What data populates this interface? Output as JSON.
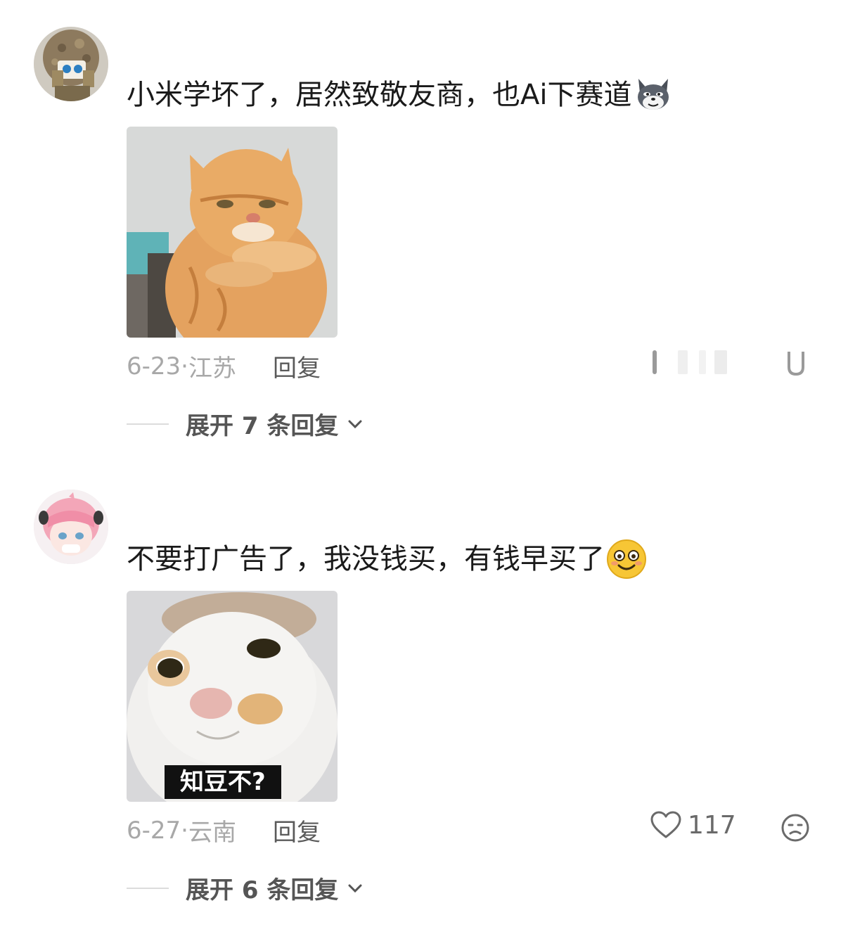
{
  "comments": [
    {
      "text": "小米学坏了，居然致敬友商，也Ai下赛道",
      "emoji": "wolf-emoji",
      "sticker": "orange-cat-bowing",
      "date": "6-23",
      "sep": "·",
      "location": "江苏",
      "reply_label": "回复",
      "expand_label": "展开 7 条回复"
    },
    {
      "text": "不要打广告了，我没钱买，有钱早买了",
      "emoji": "smile-emoji",
      "sticker": "white-cat-stare",
      "sticker_caption": "知豆不?",
      "date": "6-27",
      "sep": "·",
      "location": "云南",
      "reply_label": "回复",
      "like_count": "117",
      "expand_label": "展开 6 条回复"
    }
  ],
  "colors": {
    "text": "#1a1a1a",
    "meta": "#a8a8a8",
    "reply": "#5a5a5a",
    "expand": "#555555"
  }
}
